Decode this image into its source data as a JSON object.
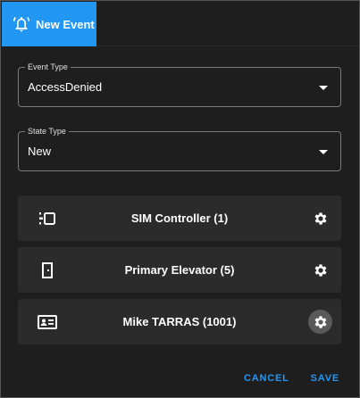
{
  "dialog": {
    "title": "New Event",
    "title_icon": "bell-ring-icon",
    "accent_color": "#2196f3"
  },
  "fields": {
    "event_type": {
      "label": "Event Type",
      "value": "AccessDenied"
    },
    "state_type": {
      "label": "State Type",
      "value": "New"
    }
  },
  "items": [
    {
      "label": "SIM Controller (1)",
      "icon": "controller-icon",
      "action_icon": "gear-icon"
    },
    {
      "label": "Primary Elevator (5)",
      "icon": "door-icon",
      "action_icon": "gear-icon"
    },
    {
      "label": "Mike TARRAS (1001)",
      "icon": "id-card-icon",
      "action_icon": "gear-icon"
    }
  ],
  "actions": {
    "cancel_label": "CANCEL",
    "save_label": "SAVE"
  }
}
